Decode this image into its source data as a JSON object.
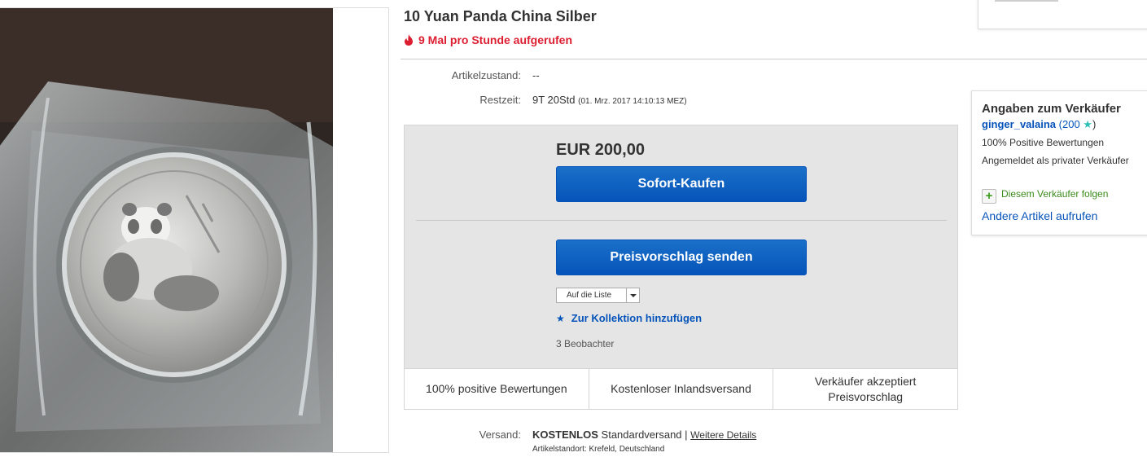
{
  "listing": {
    "title": "10 Yuan Panda China Silber",
    "views": "9 Mal pro Stunde aufgerufen",
    "condition_label": "Artikelzustand:",
    "condition_value": "--",
    "time_label": "Restzeit:",
    "time_value": "9T 20Std",
    "time_detail": "(01. Mrz. 2017   14:10:13 MEZ)"
  },
  "buybox": {
    "price": "EUR 200,00",
    "buy_now_label": "Sofort-Kaufen",
    "offer_label": "Preisvorschlag senden",
    "list_select": "Auf die Liste",
    "collection_label": "Zur Kollektion hinzufügen",
    "watchers": "3 Beobachter",
    "features": [
      "100% positive Bewertungen",
      "Kostenloser Inlandsversand",
      "Verkäufer akzeptiert Preisvorschlag"
    ]
  },
  "seller": {
    "heading": "Angaben zum Verkäufer",
    "name": "ginger_valaina",
    "score_open": " (200 ",
    "score_close": ")",
    "positive": "100% Positive Bewertungen",
    "type": "Angemeldet als privater Verkäufer",
    "follow_label": "Diesem Verkäufer folgen",
    "other_items": "Andere Artikel aufrufen"
  },
  "shipping": {
    "label": "Versand:",
    "free": "KOSTENLOS",
    "method": "Standardversand |",
    "details_link": "Weitere Details",
    "location": "Artikelstandort:  Krefeld, Deutschland"
  },
  "colors": {
    "accent": "#0654ba",
    "alert": "#dd1e31",
    "box_bg": "#e5e5e5",
    "follow_green": "#3a8a1c",
    "star_teal": "#2dbfb5"
  },
  "icons": [
    "flame-icon",
    "star-icon",
    "teal-star-icon",
    "plus-icon",
    "dropdown-arrow-icon"
  ]
}
